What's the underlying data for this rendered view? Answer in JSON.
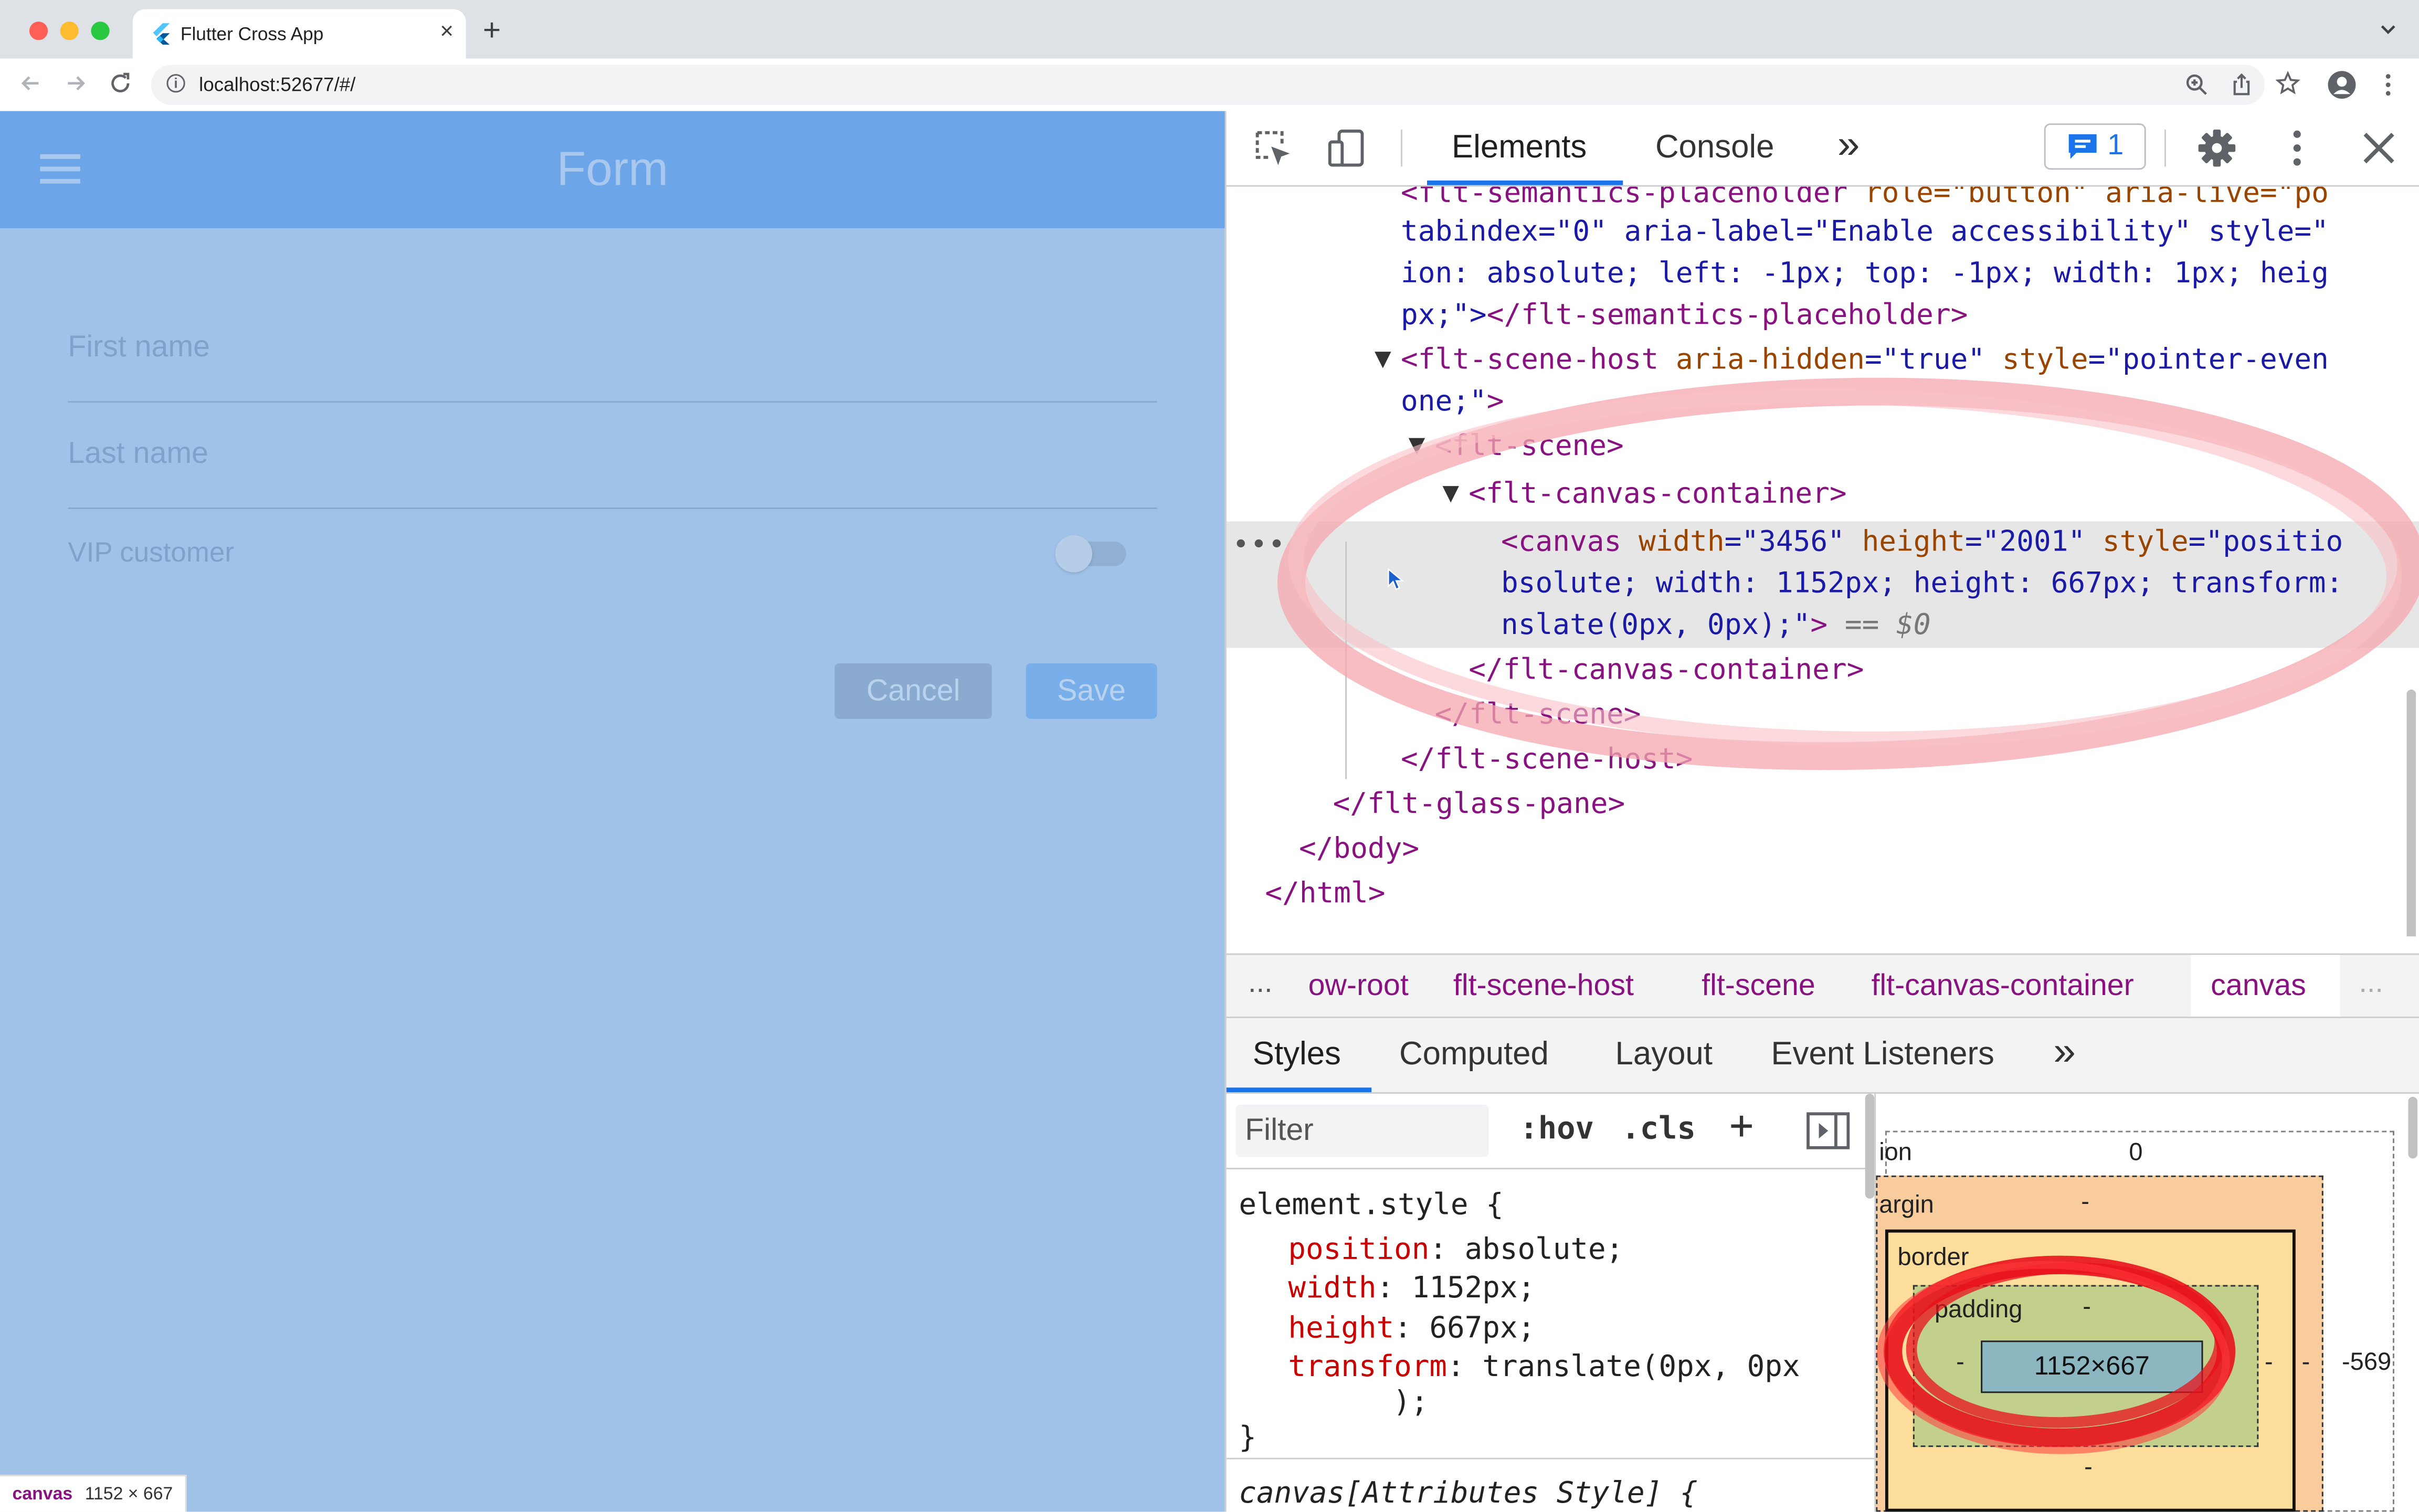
{
  "browser": {
    "tab_title": "Flutter Cross App",
    "url": "localhost:52677/#/"
  },
  "app": {
    "title": "Form",
    "first_name_label": "First name",
    "last_name_label": "Last name",
    "vip_label": "VIP customer",
    "vip_enabled": false,
    "cancel_label": "Cancel",
    "save_label": "Save",
    "hover_tip_tag": "canvas",
    "hover_tip_size": "1152 × 667"
  },
  "devtools": {
    "tabs": {
      "elements": "Elements",
      "console": "Console",
      "more": "»"
    },
    "issues_count": "1",
    "dom": {
      "l1_tag": "<flt-semantics-placeholder",
      "l1_attrs": " role=\"button\" aria-live=\"po",
      "l2": "tabindex=\"0\" aria-label=\"Enable accessibility\" style=\"",
      "l3": "ion: absolute; left: -1px; top: -1px; width: 1px; heig",
      "l4a": "px;\">",
      "l4b": "</flt-semantics-placeholder>",
      "l5_tag": "<flt-scene-host",
      "l5_an1": " aria-hidden",
      "l5_av1": "=\"true\"",
      "l5_an2": " style",
      "l5_av2": "=\"pointer-even",
      "l6a": "one;\"",
      "l6b": ">",
      "l7": "<flt-scene>",
      "l8": "<flt-canvas-container>",
      "l9_tag": "<canvas",
      "l9_an1": " width",
      "l9_av1": "=\"3456\"",
      "l9_an2": " height",
      "l9_av2": "=\"2001\"",
      "l9_an3": " style",
      "l9_av3": "=\"positio",
      "l10": "bsolute; width: 1152px; height: 667px; transform:",
      "l11a": "nslate(0px, 0px);\"",
      "l11b": ">",
      "l11c": " == $0",
      "l12": "</flt-canvas-container>",
      "l13": "</flt-scene>",
      "l14": "</flt-scene-host>",
      "l15": "</flt-glass-pane>",
      "l16": "</body>",
      "l17": "</html>",
      "more_dots": "•••"
    },
    "breadcrumbs": [
      "...",
      "ow-root",
      "flt-scene-host",
      "flt-scene",
      "flt-canvas-container",
      "canvas",
      "..."
    ],
    "subtabs": {
      "styles": "Styles",
      "computed": "Computed",
      "layout": "Layout",
      "listeners": "Event Listeners",
      "more": "»"
    },
    "filter_placeholder": "Filter",
    "hov": ":hov",
    "cls": ".cls",
    "plus": "+",
    "styles": {
      "selector": "element.style {",
      "p1": "position",
      "v1": ": absolute;",
      "p2": "width",
      "v2": ": 1152px;",
      "p3": "height",
      "v3": ": 667px;",
      "p4": "transform",
      "v4": ": translate(0px, 0px",
      "v4b": ");",
      "close": "}",
      "selector2": "canvas[Attributes Style] {"
    },
    "boxmodel": {
      "position_label": "ion",
      "position_value": "0",
      "margin_label": "argin",
      "margin_value": "-",
      "border_label": "border",
      "padding_label": "padding",
      "padding_value": "-",
      "content": "1152×667",
      "side_left": "-",
      "side_right": "-",
      "border_right": "-",
      "right_value": "-569",
      "bottom_value": "-"
    }
  },
  "colors": {
    "app_bg": "#a1c2e8",
    "appbar": "#6da6e8",
    "annotation_pink": "#f4a7ae",
    "annotation_red": "#e8121c",
    "devtools_accent": "#1a73e8"
  }
}
